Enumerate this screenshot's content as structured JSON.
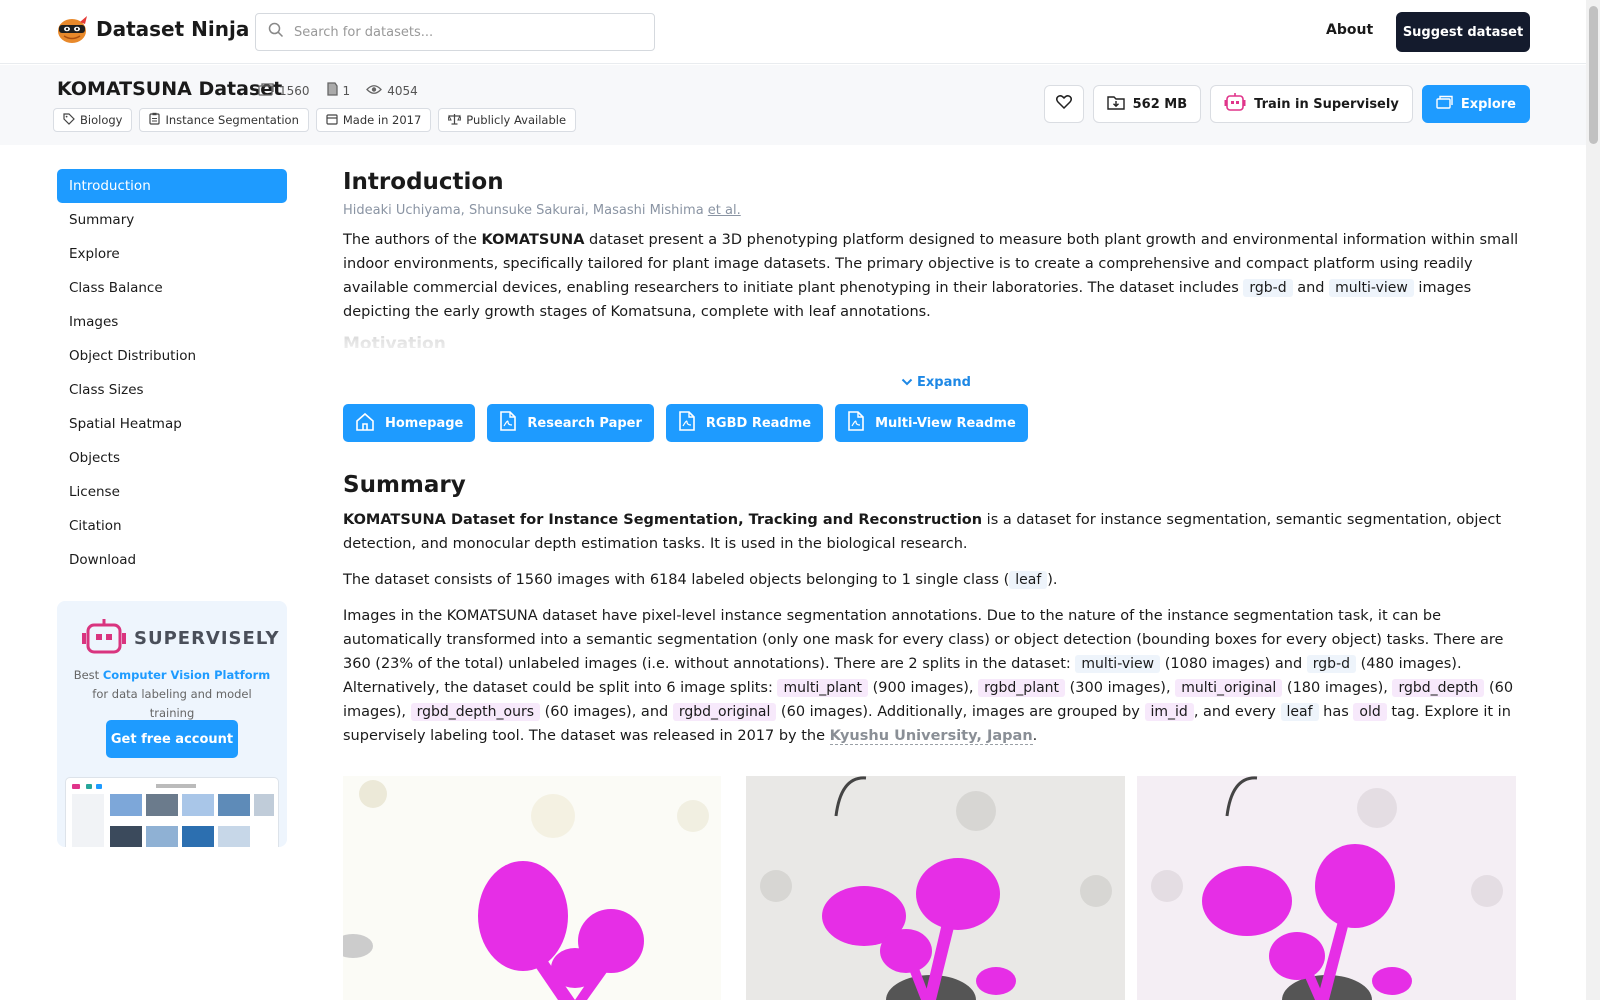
{
  "header": {
    "brand": "Dataset Ninja",
    "search_placeholder": "Search for datasets...",
    "about": "About",
    "suggest": "Suggest dataset"
  },
  "dataset": {
    "title": "KOMATSUNA Dataset",
    "stats": {
      "images": "1560",
      "classes": "1",
      "views": "4054"
    },
    "tags": [
      "Biology",
      "Instance Segmentation",
      "Made in 2017",
      "Publicly Available"
    ],
    "size": "562 MB",
    "train_label": "Train in Supervisely",
    "explore_label": "Explore"
  },
  "sidebar": {
    "items": [
      "Introduction",
      "Summary",
      "Explore",
      "Class Balance",
      "Images",
      "Object Distribution",
      "Class Sizes",
      "Spatial Heatmap",
      "Objects",
      "License",
      "Citation",
      "Download"
    ],
    "active": "Introduction"
  },
  "promo": {
    "brand": "SUPERVISELY",
    "text_before": "Best ",
    "text_link": "Computer Vision Platform",
    "text_after": " for data labeling and model training",
    "button": "Get free account"
  },
  "intro": {
    "heading": "Introduction",
    "authors": "Hideaki Uchiyama, Shunsuke Sakurai, Masashi Mishima",
    "et_al": "et al.",
    "p1_a": "The authors of the ",
    "p1_bold": "KOMATSUNA",
    "p1_b": " dataset present a 3D phenotyping platform designed to measure both plant growth and environmental information within small indoor environments, specifically tailored for plant image datasets. The primary objective is to create a comprehensive and compact platform using readily available commercial devices, enabling researchers to initiate plant phenotyping in their laboratories. The dataset includes ",
    "p1_code1": "rgb-d",
    "p1_c": " and ",
    "p1_code2": "multi-view",
    "p1_d": " images depicting the early growth stages of Komatsuna, complete with leaf annotations.",
    "faded_heading": "Motivation",
    "expand": "Expand",
    "links": [
      "Homepage",
      "Research Paper",
      "RGBD Readme",
      "Multi-View Readme"
    ]
  },
  "summary": {
    "heading": "Summary",
    "p1_bold": "KOMATSUNA Dataset for Instance Segmentation, Tracking and Reconstruction",
    "p1_rest": " is a dataset for instance segmentation, semantic segmentation, object detection, and monocular depth estimation tasks. It is used in the biological research.",
    "p2_a": "The dataset consists of 1560 images with 6184 labeled objects belonging to 1 single class (",
    "p2_code": "leaf",
    "p2_b": ").",
    "p3_a": "Images in the KOMATSUNA dataset have pixel-level instance segmentation annotations. Due to the nature of the instance segmentation task, it can be automatically transformed into a semantic segmentation (only one mask for every class) or object detection (bounding boxes for every object) tasks. There are 360 (23% of the total) unlabeled images (i.e. without annotations). There are 2 splits in the dataset: ",
    "s1": "multi-view",
    "p3_b": " (1080 images) and ",
    "s2": "rgb-d",
    "p3_c": " (480 images). Alternatively, the dataset could be split into 6 image splits: ",
    "t1": "multi_plant",
    "p3_d": " (900 images), ",
    "t2": "rgbd_plant",
    "p3_e": " (300 images), ",
    "t3": "multi_original",
    "p3_f": " (180 images), ",
    "t4": "rgbd_depth",
    "p3_g": " (60 images), ",
    "t5": "rgbd_depth_ours",
    "p3_h": " (60 images), and ",
    "t6": "rgbd_original",
    "p3_i": " (60 images). Additionally, images are grouped by ",
    "t7": "im_id",
    "p3_j": ", and every ",
    "t8": "leaf",
    "p3_k": " has ",
    "t9": "old",
    "p3_l": " tag. Explore it in supervisely labeling tool. The dataset was released in 2017 by the ",
    "uni": "Kyushu University, Japan",
    "p3_m": "."
  },
  "colors": {
    "accent": "#1e9bff",
    "dark": "#141b2d",
    "mask": "#e62ee6"
  }
}
